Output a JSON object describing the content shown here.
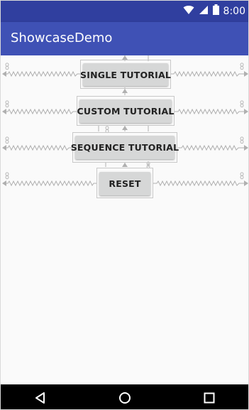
{
  "status_bar": {
    "time": "8:00",
    "icons": [
      "wifi-icon",
      "signal-icon",
      "battery-icon"
    ]
  },
  "app_bar": {
    "title": "ShowcaseDemo"
  },
  "buttons": [
    {
      "label": "SINGLE TUTORIAL"
    },
    {
      "label": "CUSTOM TUTORIAL"
    },
    {
      "label": "SEQUENCE TUTORIAL"
    },
    {
      "label": "RESET"
    }
  ],
  "nav_bar": {
    "icons": [
      "back-icon",
      "home-icon",
      "recents-icon"
    ]
  },
  "colors": {
    "status_bar": "#303f9f",
    "app_bar": "#3f51b5",
    "button": "#d6d7d7",
    "constraint": "#b0b0b0"
  }
}
